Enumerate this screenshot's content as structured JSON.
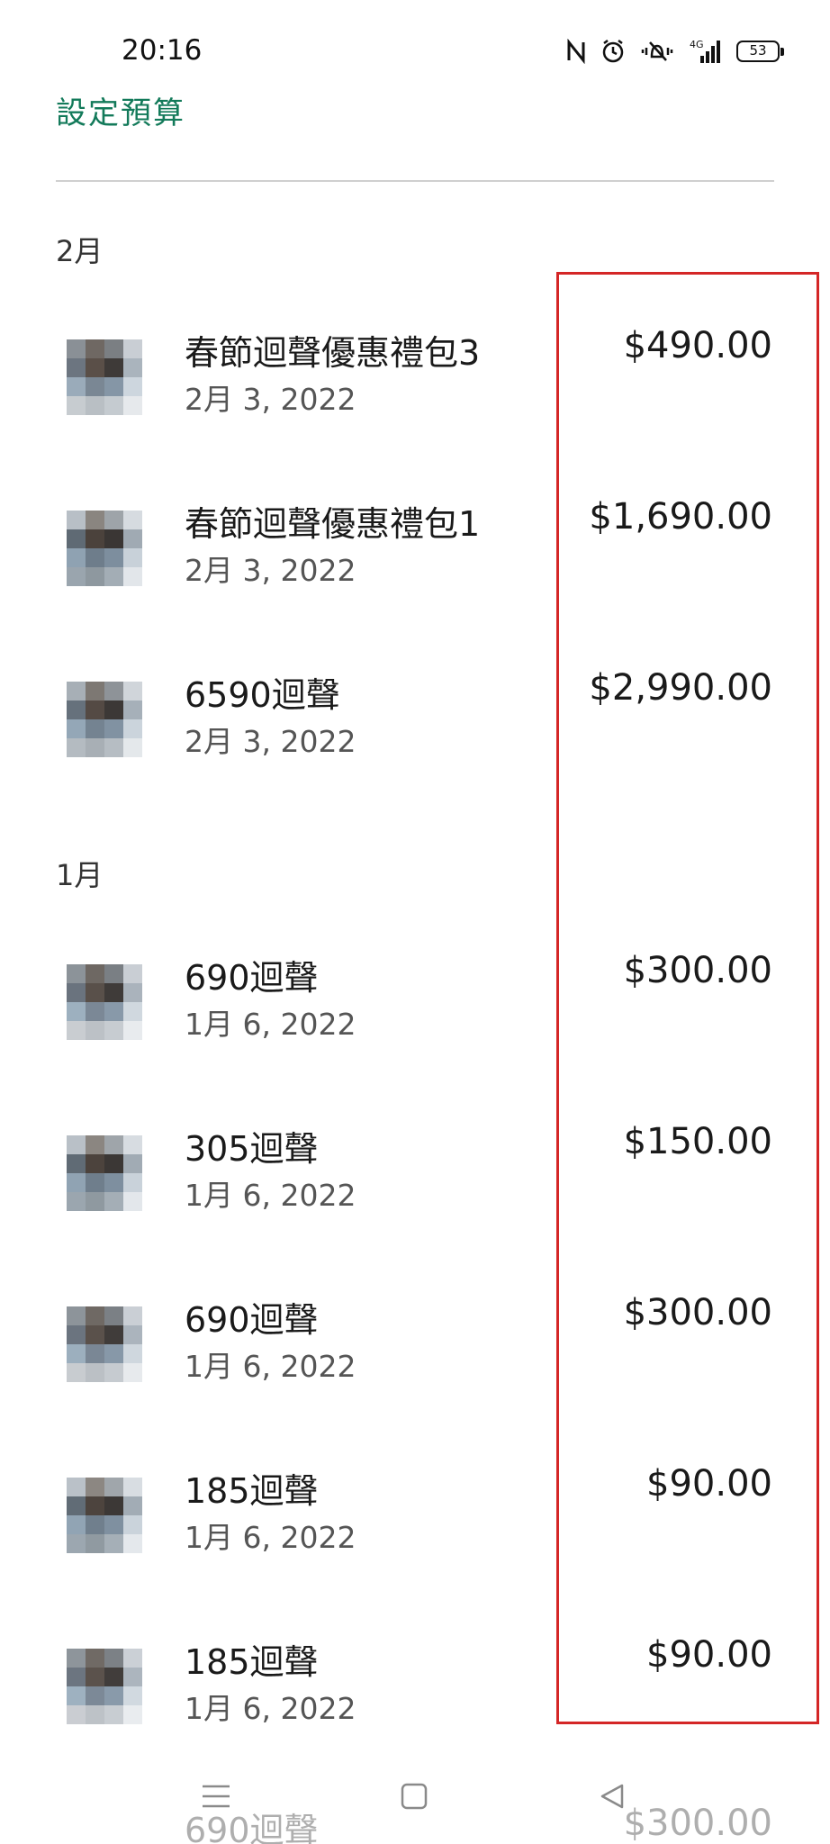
{
  "status_bar": {
    "time": "20:16",
    "battery": "53"
  },
  "header": {
    "set_budget_label": "設定預算"
  },
  "months": [
    {
      "label": "2月",
      "items": [
        {
          "title": "春節迴聲優惠禮包3",
          "date": "2月 3, 2022",
          "amount": "$490.00"
        },
        {
          "title": "春節迴聲優惠禮包1",
          "date": "2月 3, 2022",
          "amount": "$1,690.00"
        },
        {
          "title": "6590迴聲",
          "date": "2月 3, 2022",
          "amount": "$2,990.00"
        }
      ]
    },
    {
      "label": "1月",
      "items": [
        {
          "title": "690迴聲",
          "date": "1月 6, 2022",
          "amount": "$300.00"
        },
        {
          "title": "305迴聲",
          "date": "1月 6, 2022",
          "amount": "$150.00"
        },
        {
          "title": "690迴聲",
          "date": "1月 6, 2022",
          "amount": "$300.00"
        },
        {
          "title": "185迴聲",
          "date": "1月 6, 2022",
          "amount": "$90.00"
        },
        {
          "title": "185迴聲",
          "date": "1月 6, 2022",
          "amount": "$90.00"
        }
      ]
    }
  ],
  "peek_item": {
    "title": "690迴聲",
    "amount": "$300.00"
  },
  "colors": {
    "accent": "#137a5a",
    "highlight": "#d42626"
  },
  "icons": {
    "status": [
      "nfc-icon",
      "alarm-icon",
      "vibrate-icon",
      "signal-4g-icon",
      "battery-icon"
    ],
    "nav": [
      "menu-icon",
      "home-icon",
      "back-icon"
    ]
  }
}
